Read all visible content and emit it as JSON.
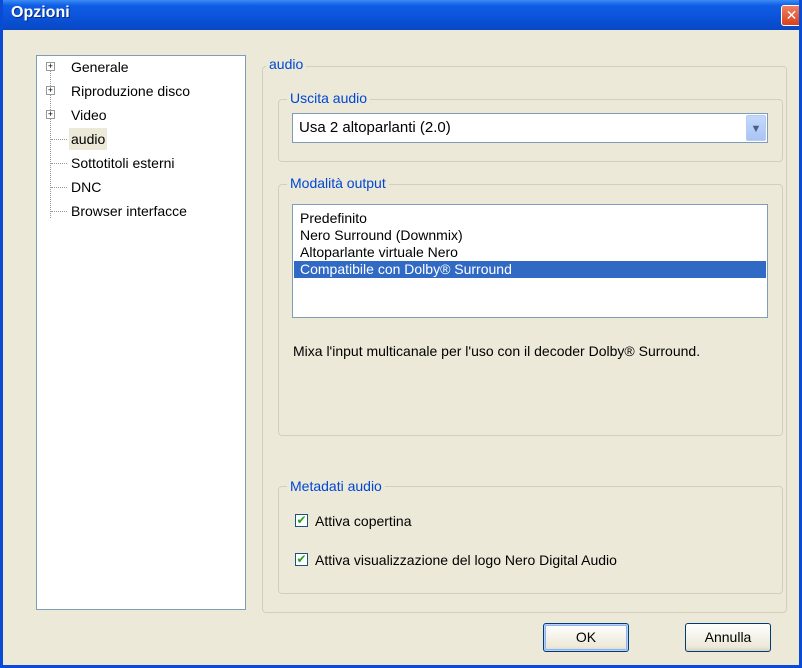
{
  "window": {
    "title": "Opzioni",
    "close_label": "✕"
  },
  "tree": {
    "items": [
      {
        "label": "Generale",
        "expandable": true,
        "toggle": "+"
      },
      {
        "label": "Riproduzione disco",
        "expandable": true,
        "toggle": "+"
      },
      {
        "label": "Video",
        "expandable": true,
        "toggle": "+"
      },
      {
        "label": "audio",
        "expandable": false,
        "selected": true
      },
      {
        "label": "Sottotitoli esterni",
        "expandable": false
      },
      {
        "label": "DNC",
        "expandable": false
      },
      {
        "label": "Browser interfacce",
        "expandable": false
      }
    ]
  },
  "panel": {
    "title": "audio",
    "audio_output": {
      "title": "Uscita audio",
      "selected_value": "Usa 2 altoparlanti (2.0)",
      "arrow": "▼"
    },
    "output_mode": {
      "title": "Modalità output",
      "options": [
        "Predefinito",
        "Nero Surround (Downmix)",
        "Altoparlante virtuale Nero",
        "Compatibile con Dolby® Surround"
      ],
      "selected_index": 3,
      "description": "Mixa l'input multicanale per l'uso con il decoder Dolby® Surround."
    },
    "metadata": {
      "title": "Metadati audio",
      "checkboxes": [
        {
          "label": "Attiva copertina",
          "checked": true
        },
        {
          "label": "Attiva visualizzazione del logo Nero Digital Audio",
          "checked": true
        }
      ],
      "check_glyph": "✔"
    }
  },
  "buttons": {
    "ok": "OK",
    "cancel": "Annulla"
  }
}
